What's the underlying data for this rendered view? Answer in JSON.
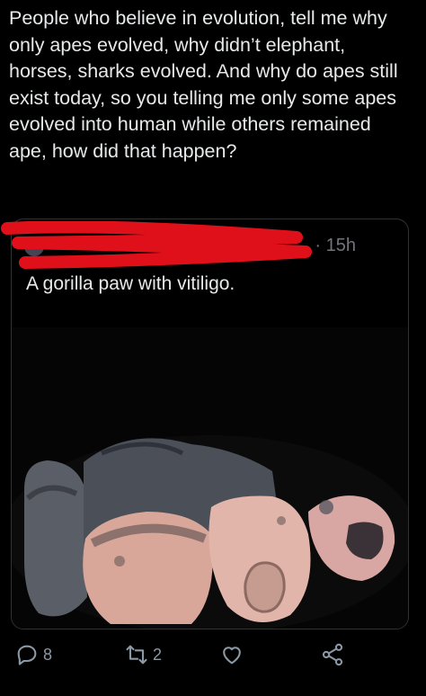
{
  "post": {
    "text": "People who believe in evolution, tell me why only apes evolved, why didn’t elephant, horses, sharks evolved. And why do apes still exist today, so you telling me only some apes evolved into human while others remained ape, how did that happen?"
  },
  "quote": {
    "time": "· 15h",
    "text": "A gorilla paw with vitiligo.",
    "image_icon": "gorilla-paw-photo"
  },
  "actions": {
    "reply_icon": "reply-icon",
    "reply_count": "8",
    "retweet_icon": "retweet-icon",
    "retweet_count": "2",
    "like_icon": "heart-icon",
    "share_icon": "share-icon"
  },
  "colors": {
    "background": "#000000",
    "text": "#e7e9ea",
    "muted": "#71767b",
    "scribble": "#e0101a",
    "icon": "#8b98a5"
  }
}
